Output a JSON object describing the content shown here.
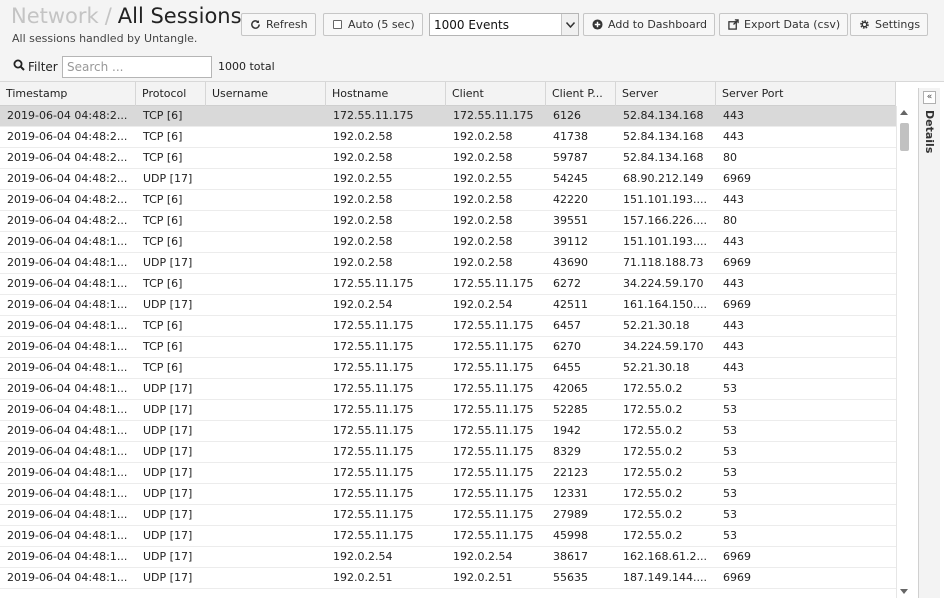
{
  "header": {
    "breadcrumb_parent": "Network",
    "separator": "/",
    "title": "All Sessions",
    "subtitle": "All sessions handled by Untangle."
  },
  "toolbar": {
    "refresh_label": "Refresh",
    "auto_label": "Auto (5 sec)",
    "auto_checked": false,
    "events_selected": "1000 Events",
    "add_dashboard_label": "Add to Dashboard",
    "export_label": "Export Data (csv)",
    "settings_label": "Settings"
  },
  "filter": {
    "label": "Filter",
    "placeholder": "Search ...",
    "value": "",
    "total": "1000 total"
  },
  "grid": {
    "columns": [
      "Timestamp",
      "Protocol",
      "Username",
      "Hostname",
      "Client",
      "Client P...",
      "Server",
      "Server Port"
    ],
    "rows": [
      [
        "2019-06-04 04:48:2...",
        "TCP [6]",
        "",
        "172.55.11.175",
        "172.55.11.175",
        "6126",
        "52.84.134.168",
        "443"
      ],
      [
        "2019-06-04 04:48:2...",
        "TCP [6]",
        "",
        "192.0.2.58",
        "192.0.2.58",
        "41738",
        "52.84.134.168",
        "443"
      ],
      [
        "2019-06-04 04:48:2...",
        "TCP [6]",
        "",
        "192.0.2.58",
        "192.0.2.58",
        "59787",
        "52.84.134.168",
        "80"
      ],
      [
        "2019-06-04 04:48:2...",
        "UDP [17]",
        "",
        "192.0.2.55",
        "192.0.2.55",
        "54245",
        "68.90.212.149",
        "6969"
      ],
      [
        "2019-06-04 04:48:2...",
        "TCP [6]",
        "",
        "192.0.2.58",
        "192.0.2.58",
        "42220",
        "151.101.193....",
        "443"
      ],
      [
        "2019-06-04 04:48:2...",
        "TCP [6]",
        "",
        "192.0.2.58",
        "192.0.2.58",
        "39551",
        "157.166.226....",
        "80"
      ],
      [
        "2019-06-04 04:48:1...",
        "TCP [6]",
        "",
        "192.0.2.58",
        "192.0.2.58",
        "39112",
        "151.101.193....",
        "443"
      ],
      [
        "2019-06-04 04:48:1...",
        "UDP [17]",
        "",
        "192.0.2.58",
        "192.0.2.58",
        "43690",
        "71.118.188.73",
        "6969"
      ],
      [
        "2019-06-04 04:48:1...",
        "TCP [6]",
        "",
        "172.55.11.175",
        "172.55.11.175",
        "6272",
        "34.224.59.170",
        "443"
      ],
      [
        "2019-06-04 04:48:1...",
        "UDP [17]",
        "",
        "192.0.2.54",
        "192.0.2.54",
        "42511",
        "161.164.150....",
        "6969"
      ],
      [
        "2019-06-04 04:48:1...",
        "TCP [6]",
        "",
        "172.55.11.175",
        "172.55.11.175",
        "6457",
        "52.21.30.18",
        "443"
      ],
      [
        "2019-06-04 04:48:1...",
        "TCP [6]",
        "",
        "172.55.11.175",
        "172.55.11.175",
        "6270",
        "34.224.59.170",
        "443"
      ],
      [
        "2019-06-04 04:48:1...",
        "TCP [6]",
        "",
        "172.55.11.175",
        "172.55.11.175",
        "6455",
        "52.21.30.18",
        "443"
      ],
      [
        "2019-06-04 04:48:1...",
        "UDP [17]",
        "",
        "172.55.11.175",
        "172.55.11.175",
        "42065",
        "172.55.0.2",
        "53"
      ],
      [
        "2019-06-04 04:48:1...",
        "UDP [17]",
        "",
        "172.55.11.175",
        "172.55.11.175",
        "52285",
        "172.55.0.2",
        "53"
      ],
      [
        "2019-06-04 04:48:1...",
        "UDP [17]",
        "",
        "172.55.11.175",
        "172.55.11.175",
        "1942",
        "172.55.0.2",
        "53"
      ],
      [
        "2019-06-04 04:48:1...",
        "UDP [17]",
        "",
        "172.55.11.175",
        "172.55.11.175",
        "8329",
        "172.55.0.2",
        "53"
      ],
      [
        "2019-06-04 04:48:1...",
        "UDP [17]",
        "",
        "172.55.11.175",
        "172.55.11.175",
        "22123",
        "172.55.0.2",
        "53"
      ],
      [
        "2019-06-04 04:48:1...",
        "UDP [17]",
        "",
        "172.55.11.175",
        "172.55.11.175",
        "12331",
        "172.55.0.2",
        "53"
      ],
      [
        "2019-06-04 04:48:1...",
        "UDP [17]",
        "",
        "172.55.11.175",
        "172.55.11.175",
        "27989",
        "172.55.0.2",
        "53"
      ],
      [
        "2019-06-04 04:48:1...",
        "UDP [17]",
        "",
        "172.55.11.175",
        "172.55.11.175",
        "45998",
        "172.55.0.2",
        "53"
      ],
      [
        "2019-06-04 04:48:1...",
        "UDP [17]",
        "",
        "192.0.2.54",
        "192.0.2.54",
        "38617",
        "162.168.61.2...",
        "6969"
      ],
      [
        "2019-06-04 04:48:1...",
        "UDP [17]",
        "",
        "192.0.2.51",
        "192.0.2.51",
        "55635",
        "187.149.144....",
        "6969"
      ]
    ]
  },
  "details_panel": {
    "label": "Details",
    "collapse_glyph": "«"
  },
  "icons": {
    "refresh": "refresh-icon",
    "add": "plus-circle-icon",
    "export": "external-link-icon",
    "settings": "gear-icon",
    "search": "search-icon",
    "dropdown": "chevron-down-icon"
  },
  "colors": {
    "header_bg": "#f4f4f4",
    "selected_row": "#d9d9d9",
    "breadcrumb_parent": "#c4c4c4"
  }
}
